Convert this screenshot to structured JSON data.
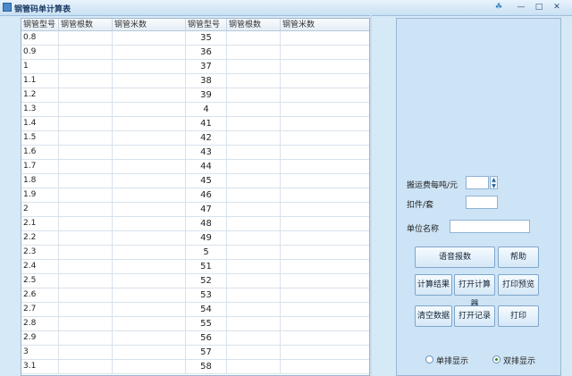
{
  "window": {
    "title": "钢管码单计算表"
  },
  "table": {
    "headers": [
      "钢管型号",
      "钢管根数",
      "钢管米数",
      "钢管型号",
      "钢管根数",
      "钢管米数"
    ],
    "left_types": [
      "0.8",
      "0.9",
      "1",
      "1.1",
      "1.2",
      "1.3",
      "1.4",
      "1.5",
      "1.6",
      "1.7",
      "1.8",
      "1.9",
      "2",
      "2.1",
      "2.2",
      "2.3",
      "2.4",
      "2.5",
      "2.6",
      "2.7",
      "2.8",
      "2.9",
      "3",
      "3.1"
    ],
    "right_types": [
      "35",
      "36",
      "37",
      "38",
      "39",
      "4",
      "41",
      "42",
      "43",
      "44",
      "45",
      "46",
      "47",
      "48",
      "49",
      "5",
      "51",
      "52",
      "53",
      "54",
      "55",
      "56",
      "57",
      "58"
    ]
  },
  "panel": {
    "freight_label": "搬运费每吨/元",
    "freight_value": "",
    "discount_label": "扣件/套",
    "discount_value": "",
    "unit_label": "单位名称",
    "unit_value": "",
    "buttons": {
      "voice_report": "语音报数",
      "help": "帮助",
      "calc_result": "计算结果",
      "open_calculator": "打开计算器",
      "print_preview": "打印预览",
      "clear_data": "清空数据",
      "open_records": "打开记录",
      "print": "打印"
    },
    "radio_single": "单排显示",
    "radio_double": "双排显示",
    "selected_mode": "双排显示"
  }
}
